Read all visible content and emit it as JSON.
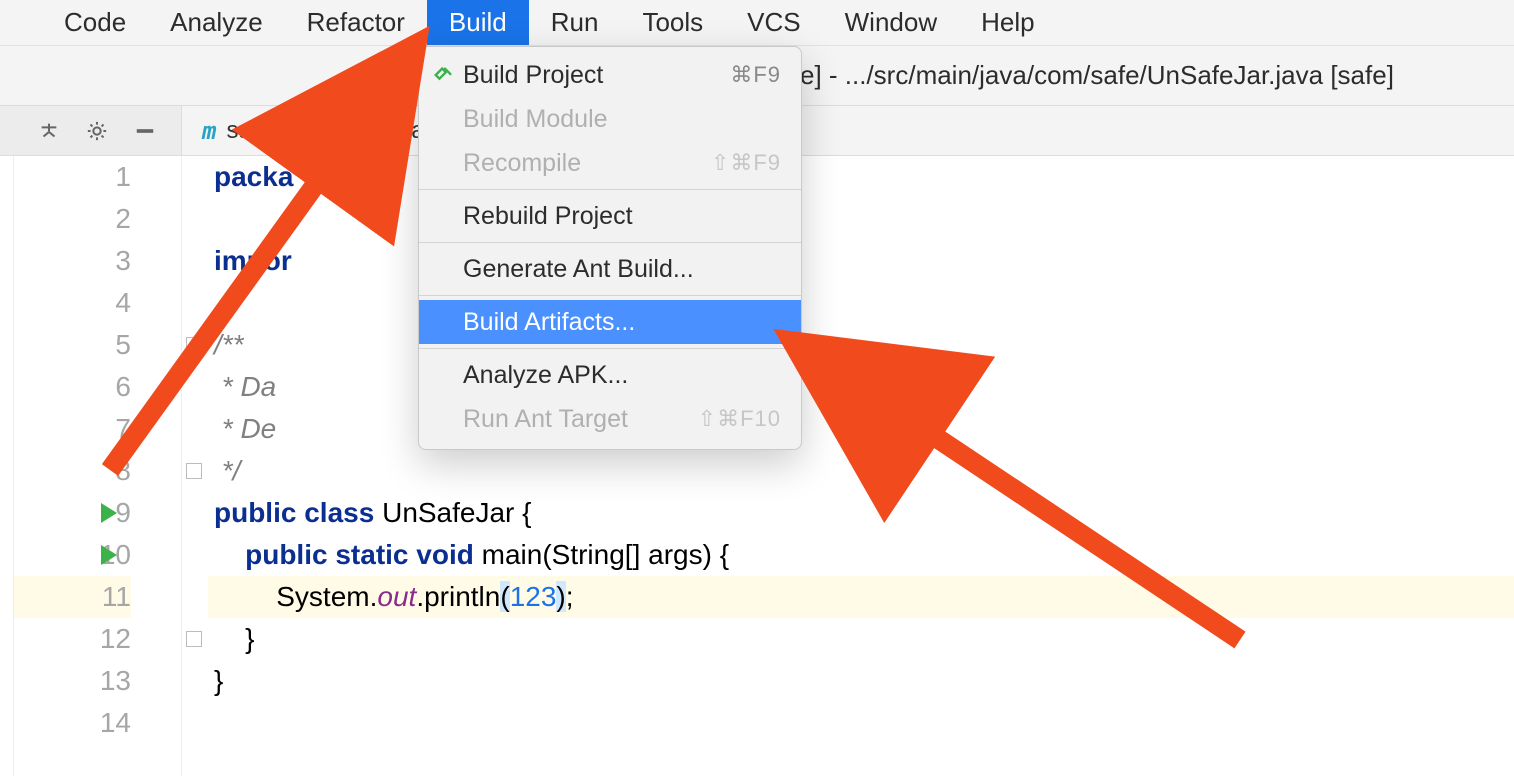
{
  "menubar": {
    "items": [
      {
        "label": "Code"
      },
      {
        "label": "Analyze"
      },
      {
        "label": "Refactor"
      },
      {
        "label": "Build",
        "active": true
      },
      {
        "label": "Run"
      },
      {
        "label": "Tools"
      },
      {
        "label": "VCS"
      },
      {
        "label": "Window"
      },
      {
        "label": "Help"
      }
    ]
  },
  "pathbar": {
    "text": "e] - .../src/main/java/com/safe/UnSafeJar.java [safe]"
  },
  "tabs": {
    "items": [
      {
        "icon": "m",
        "label": "safe",
        "active": false
      },
      {
        "icon": "",
        "label": "UnSa",
        "active": true
      }
    ]
  },
  "dropdown": {
    "items": [
      {
        "type": "item",
        "label": "Build Project",
        "shortcut": "⌘F9",
        "icon": "hammer",
        "disabled": false
      },
      {
        "type": "item",
        "label": "Build Module",
        "shortcut": "",
        "disabled": true
      },
      {
        "type": "item",
        "label": "Recompile",
        "shortcut": "⇧⌘F9",
        "disabled": true
      },
      {
        "type": "sep"
      },
      {
        "type": "item",
        "label": "Rebuild Project",
        "shortcut": "",
        "disabled": false
      },
      {
        "type": "sep"
      },
      {
        "type": "item",
        "label": "Generate Ant Build...",
        "shortcut": "",
        "disabled": false
      },
      {
        "type": "sep"
      },
      {
        "type": "item",
        "label": "Build Artifacts...",
        "shortcut": "",
        "disabled": false,
        "selected": true
      },
      {
        "type": "sep"
      },
      {
        "type": "item",
        "label": "Analyze APK...",
        "shortcut": "",
        "disabled": false
      },
      {
        "type": "item",
        "label": "Run Ant Target",
        "shortcut": "⇧⌘F10",
        "disabled": true
      }
    ]
  },
  "editor": {
    "highlight_line": 11,
    "lines": [
      {
        "n": 1,
        "tokens": [
          {
            "t": "package",
            "c": "kw"
          },
          {
            "t": " ",
            "c": "id"
          }
        ],
        "truncated_under_menu": true,
        "display": "packa"
      },
      {
        "n": 2,
        "tokens": []
      },
      {
        "n": 3,
        "tokens": [
          {
            "t": "import",
            "c": "kw"
          },
          {
            "t": " ",
            "c": "id"
          }
        ],
        "truncated_under_menu": true,
        "display": "impor"
      },
      {
        "n": 4,
        "tokens": []
      },
      {
        "n": 5,
        "tokens": [
          {
            "t": "/**",
            "c": "comment"
          }
        ],
        "fold": "open"
      },
      {
        "n": 6,
        "tokens": [
          {
            "t": " * Da",
            "c": "comment"
          }
        ]
      },
      {
        "n": 7,
        "tokens": [
          {
            "t": " * De",
            "c": "comment"
          }
        ]
      },
      {
        "n": 8,
        "tokens": [
          {
            "t": " */",
            "c": "comment"
          }
        ],
        "fold": "close"
      },
      {
        "n": 9,
        "run": true,
        "tokens": [
          {
            "t": "public",
            "c": "kw"
          },
          {
            "t": " ",
            "c": "id"
          },
          {
            "t": "class",
            "c": "kw"
          },
          {
            "t": " UnSafeJar {",
            "c": "id"
          }
        ]
      },
      {
        "n": 10,
        "run": true,
        "tokens": [
          {
            "t": "    ",
            "c": "id"
          },
          {
            "t": "public",
            "c": "kw"
          },
          {
            "t": " ",
            "c": "id"
          },
          {
            "t": "static",
            "c": "kw"
          },
          {
            "t": " ",
            "c": "id"
          },
          {
            "t": "void",
            "c": "kw"
          },
          {
            "t": " main(String[] args) {",
            "c": "id"
          }
        ]
      },
      {
        "n": 11,
        "tokens": [
          {
            "t": "        System.",
            "c": "id"
          },
          {
            "t": "out",
            "c": "field"
          },
          {
            "t": ".println",
            "c": "id"
          },
          {
            "t": "(",
            "c": "match"
          },
          {
            "t": "123",
            "c": "num-lit"
          },
          {
            "t": ")",
            "c": "match"
          },
          {
            "t": ";",
            "c": "id"
          }
        ]
      },
      {
        "n": 12,
        "fold": "close",
        "tokens": [
          {
            "t": "    }",
            "c": "id"
          }
        ]
      },
      {
        "n": 13,
        "tokens": [
          {
            "t": "}",
            "c": "id"
          }
        ]
      },
      {
        "n": 14,
        "tokens": []
      }
    ]
  }
}
